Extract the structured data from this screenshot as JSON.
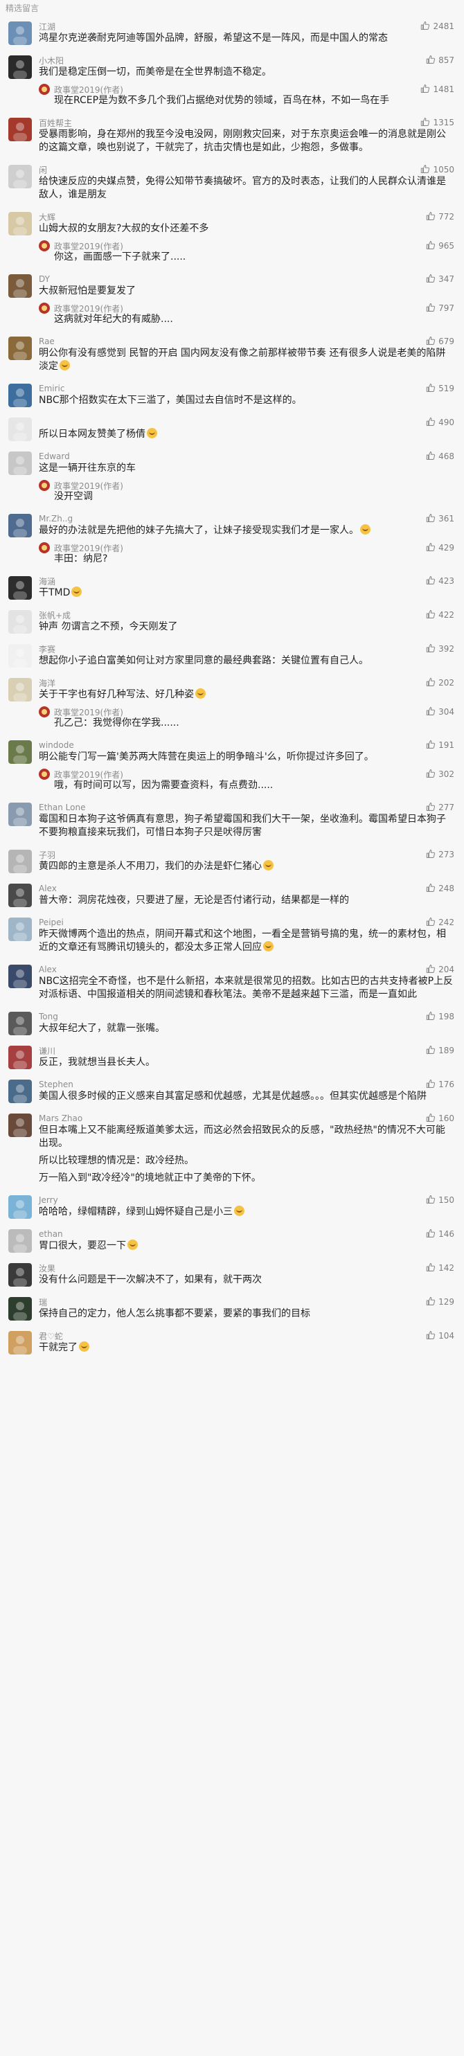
{
  "section_title": "精选留言",
  "comments": [
    {
      "name": "江湖",
      "likes": "2481",
      "text": "鸿星尔克逆袭耐克阿迪等国外品牌，舒服，希望这不是一阵风，而是中国人的常态",
      "avatar": "#6b8fb5"
    },
    {
      "name": "小木阳",
      "likes": "857",
      "text": "我们是稳定压倒一切，而美帝是在全世界制造不稳定。",
      "avatar": "#2b2b2b",
      "reply": {
        "author": "政事堂2019(作者)",
        "likes": "1481",
        "text": "现在RCEP是为数不多几个我们占据绝对优势的领域，百鸟在林，不如一鸟在手"
      }
    },
    {
      "name": "百姓帮主",
      "likes": "1315",
      "text": "受暴雨影响，身在郑州的我至今没电没网，刚刚救灾回来，对于东京奥运会唯一的消息就是刚公的这篇文章，唤也别说了，干就完了，抗击灾情也是如此，少抱怨，多做事。",
      "avatar": "#a33a2b"
    },
    {
      "name": "闲",
      "likes": "1050",
      "text": "给快速反应的央媒点赞，免得公知带节奏搞破坏。官方的及时表态，让我们的人民群众认清谁是敌人，谁是朋友",
      "avatar": "#cfcfcf"
    },
    {
      "name": "大辉",
      "likes": "772",
      "text": "山姆大叔的女朋友?大叔的女仆还差不多",
      "avatar": "#d7c9a6",
      "reply": {
        "author": "政事堂2019(作者)",
        "likes": "965",
        "text": "你这，画面感一下子就来了....."
      }
    },
    {
      "name": "DY",
      "likes": "347",
      "text": "大叔新冠怕是要复发了",
      "avatar": "#7a5c3c",
      "reply": {
        "author": "政事堂2019(作者)",
        "likes": "797",
        "text": "这病就对年纪大的有威胁...."
      }
    },
    {
      "name": "Rae",
      "likes": "679",
      "text": "明公你有没有感觉到 民智的开启 国内网友没有像之前那样被带节奏 还有很多人说是老美的陷阱 淡定",
      "avatar": "#8a6a3a",
      "emoji": true
    },
    {
      "name": "Emiric",
      "likes": "519",
      "text": "NBC那个招数实在太下三滥了，美国过去自信时不是这样的。",
      "avatar": "#3d6e9e"
    },
    {
      "name": "",
      "likes": "490",
      "text": "所以日本网友赞美了杨倩",
      "avatar": "#e6e6e6",
      "emoji": true
    },
    {
      "name": "Edward",
      "likes": "468",
      "text": "这是一辆开往东京的车",
      "avatar": "#c7c7c7",
      "reply": {
        "author": "政事堂2019(作者)",
        "likes": "",
        "text": "没开空调"
      }
    },
    {
      "name": "Mr.Zh..g",
      "likes": "361",
      "text": "最好的办法就是先把他的妹子先搞大了，让妹子接受现实我们才是一家人。",
      "avatar": "#4f6b8f",
      "emoji": true,
      "reply": {
        "author": "政事堂2019(作者)",
        "likes": "429",
        "text": "丰田：纳尼?"
      }
    },
    {
      "name": "海涵",
      "likes": "423",
      "text": "干TMD",
      "avatar": "#2d2d2d",
      "emoji": true
    },
    {
      "name": "张帆+成",
      "likes": "422",
      "text": "钟声 勿谓言之不预，今天刚发了",
      "avatar": "#e3e3e3"
    },
    {
      "name": "李赛",
      "likes": "392",
      "text": "想起你小子追白富美如何让对方家里同意的最经典套路：关键位置有自己人。",
      "avatar": "#f0f0f0"
    },
    {
      "name": "海洋",
      "likes": "202",
      "text": "关于干字也有好几种写法、好几种姿",
      "avatar": "#d8cfb5",
      "emoji": true,
      "reply": {
        "author": "政事堂2019(作者)",
        "likes": "304",
        "text": "孔乙己：我觉得你在学我......"
      }
    },
    {
      "name": "windode",
      "likes": "191",
      "text": "明公能专门写一篇'美苏两大阵营在奥运上的明争暗斗'么，听你提过许多回了。",
      "avatar": "#6a7a4a",
      "reply": {
        "author": "政事堂2019(作者)",
        "likes": "302",
        "text": "哦，有时间可以写，因为需要查资料，有点费劲....."
      }
    },
    {
      "name": "Ethan Lone",
      "likes": "277",
      "text": "霉国和日本狗子这爷俩真有意思，狗子希望霉国和我们大干一架，坐收渔利。霉国希望日本狗子不要狗粮直接来玩我们，可惜日本狗子只是吠得厉害",
      "avatar": "#8a9bb0"
    },
    {
      "name": "子羽",
      "likes": "273",
      "text": "黄四郎的主意是杀人不用刀，我们的办法是虾仁猪心",
      "avatar": "#b5b5b5",
      "emoji": true
    },
    {
      "name": "Alex",
      "likes": "248",
      "text": "普大帝：洞房花烛夜，只要进了屋，无论是否付诸行动，结果都是一样的",
      "avatar": "#4a4a4a"
    },
    {
      "name": "Peipei",
      "likes": "242",
      "text": "昨天微博两个造出的热点，阴间开幕式和这个地图，一看全是营销号搞的鬼，统一的素材包，相近的文章还有骂腾讯切镜头的，都没太多正常人回应",
      "avatar": "#9fb6c9",
      "emoji": true
    },
    {
      "name": "Alex",
      "likes": "204",
      "text": "NBC这招完全不奇怪，也不是什么新招，本来就是很常见的招数。比如古巴的古共支持者被P上反对派标语、中国报道相关的阴间滤镜和春秋笔法。美帝不是越来越下三滥，而是一直如此",
      "avatar": "#3a4a6a"
    },
    {
      "name": "Tong",
      "likes": "198",
      "text": "大叔年纪大了，就靠一张嘴。",
      "avatar": "#5a5a5a"
    },
    {
      "name": "谦川",
      "likes": "189",
      "text": "反正，我就想当县长夫人。",
      "avatar": "#a64040"
    },
    {
      "name": "Stephen",
      "likes": "176",
      "text": "美国人很多时候的正义感来自其富足感和优越感，尤其是优越感。。。但其实优越感是个陷阱",
      "avatar": "#4b6b8b"
    },
    {
      "name": "Mars Zhao",
      "likes": "160",
      "text": "但日本嘴上又不能离经叛道美爹太远，而这必然会招致民众的反感，\"政热经热\"的情况不大可能出现。",
      "avatar": "#6a4a3a",
      "paras": [
        "所以比较理想的情况是：政冷经热。",
        "万一陷入到\"政冷经冷\"的境地就正中了美帝的下怀。"
      ]
    },
    {
      "name": "Jerry",
      "likes": "150",
      "text": "哈哈哈，绿帽精辟，绿到山姆怀疑自己是小三",
      "avatar": "#7bb3d6",
      "emoji": true
    },
    {
      "name": "ethan",
      "likes": "146",
      "text": "胃口很大，要忍一下",
      "avatar": "#bbbbbb",
      "emoji": true
    },
    {
      "name": "汝果",
      "likes": "142",
      "text": "没有什么问题是干一次解决不了，如果有，就干两次",
      "avatar": "#3a3a3a"
    },
    {
      "name": "瑞",
      "likes": "129",
      "text": "保持自己的定力，他人怎么挑事都不要紧，要紧的事我们的目标",
      "avatar": "#2e3e2e"
    },
    {
      "name": "君♡蛇",
      "likes": "104",
      "text": "干就完了",
      "avatar": "#d0a060",
      "emoji": true
    }
  ]
}
